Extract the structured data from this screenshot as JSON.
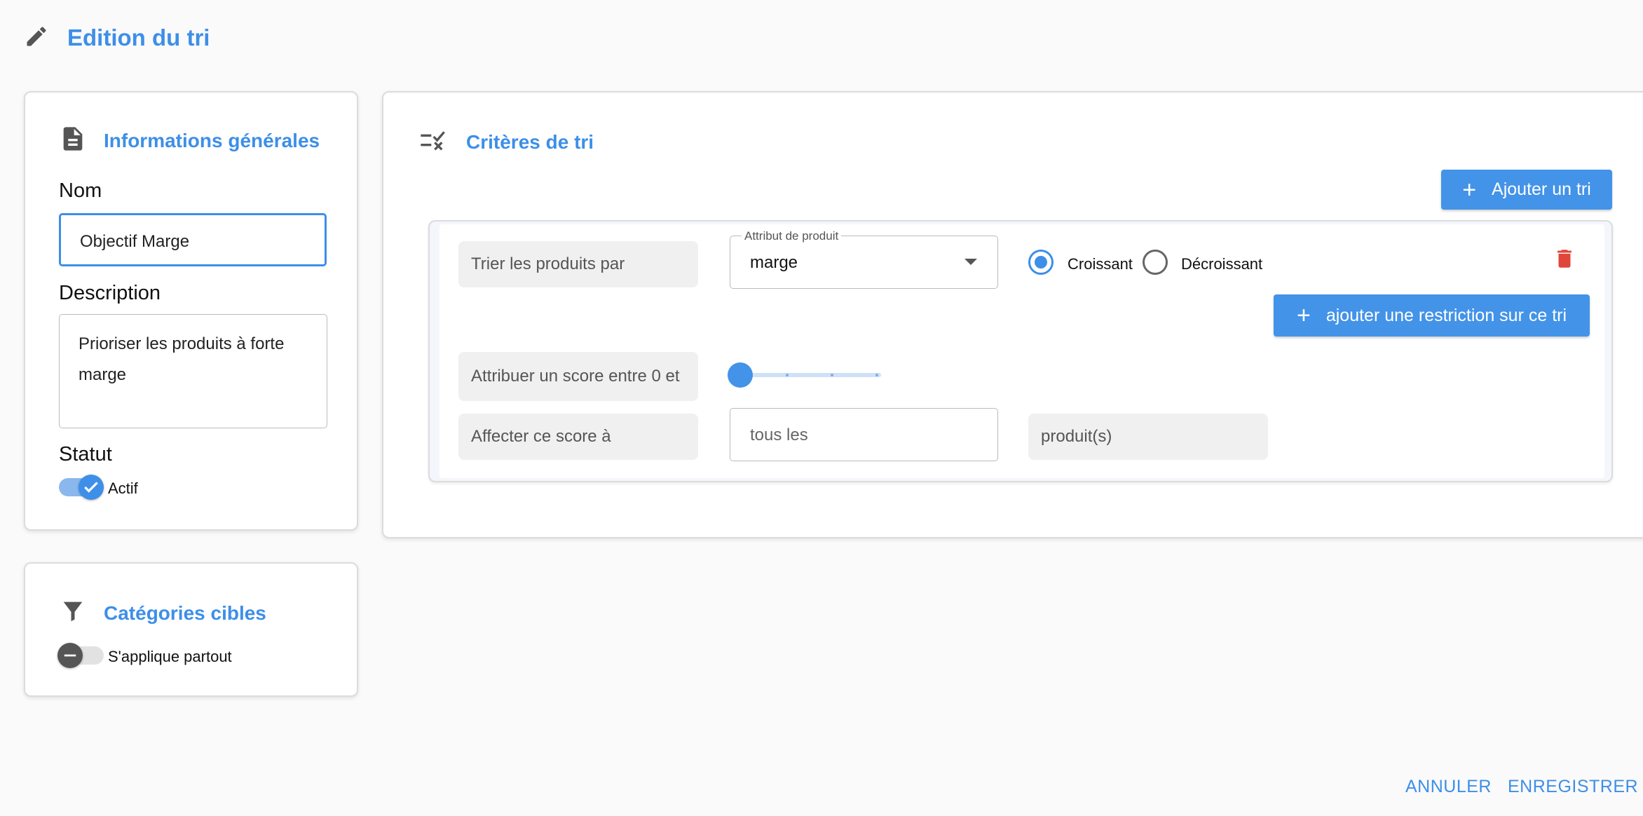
{
  "header": {
    "title": "Edition du tri",
    "icon": "pencil-icon"
  },
  "general_info": {
    "title": "Informations générales",
    "icon": "document-icon",
    "name_label": "Nom",
    "name_value": "Objectif Marge",
    "description_label": "Description",
    "description_value": "Prioriser les produits à forte marge",
    "status_label": "Statut",
    "status_toggle_label": "Actif",
    "status_on": true
  },
  "target_categories": {
    "title": "Catégories cibles",
    "icon": "filter-icon",
    "toggle_label": "S'applique partout",
    "toggle_on": false
  },
  "criteria": {
    "title": "Critères de tri",
    "icon": "checklist-icon",
    "add_sort_label": "Ajouter un tri",
    "sort_by_label": "Trier les produits par",
    "attribute_field_label": "Attribut de produit",
    "attribute_value": "marge",
    "order_options": [
      "Croissant",
      "Décroissant"
    ],
    "order_selected": "Croissant",
    "add_restriction_label": "ajouter une restriction sur ce tri",
    "score_label": "Attribuer un score entre 0 et",
    "score_slider_value": 0,
    "assign_label": "Affecter ce score à",
    "assign_input_placeholder": "tous les",
    "products_label": "produit(s)"
  },
  "footer": {
    "cancel_label": "ANNULER",
    "save_label": "ENREGISTRER"
  },
  "colors": {
    "accent": "#3d8fe8",
    "danger": "#e0463a"
  }
}
